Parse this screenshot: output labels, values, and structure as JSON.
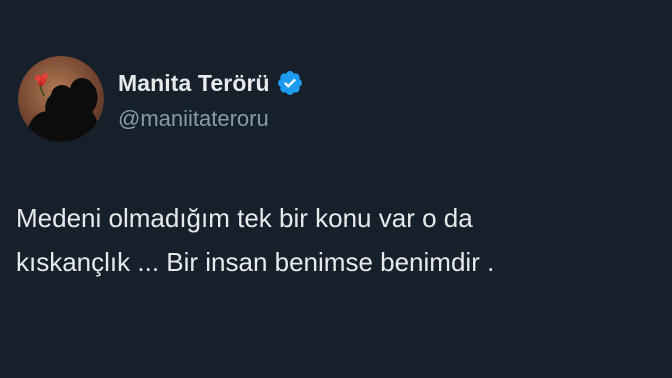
{
  "author": {
    "display_name": "Manita Terörü",
    "handle": "@maniitateroru",
    "verified": true,
    "verified_badge_color": "#1d9bf0",
    "avatar_icon": "silhouette-avatar-with-red-flower"
  },
  "tweet": {
    "text_lines": [
      "Medeni olmadığım tek bir konu var o da",
      "kıskançlık ... Bir insan benimse benimdir ."
    ]
  },
  "theme": {
    "background": "#16202b",
    "primary_text": "#e7e9ea",
    "secondary_text": "#8b98a5"
  }
}
